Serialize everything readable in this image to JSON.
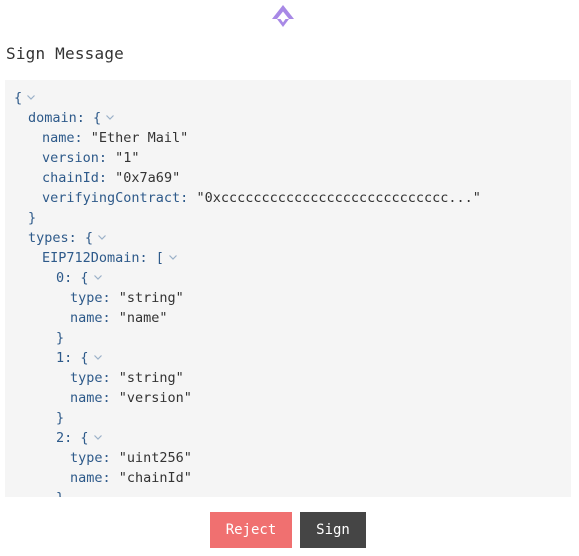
{
  "header": {
    "logo": "app-logo-icon",
    "title": "Sign Message"
  },
  "colors": {
    "accent": "#a889e6",
    "key_text": "#2e5a8a",
    "value_text": "#333333",
    "reject_bg": "#f07070",
    "sign_bg": "#454545",
    "panel_bg": "#f5f5f5"
  },
  "message_lines": [
    {
      "indent": 0,
      "key": "",
      "punct": "{",
      "value": "",
      "chevron": true
    },
    {
      "indent": 1,
      "key": "domain",
      "punct": ": {",
      "value": "",
      "chevron": true
    },
    {
      "indent": 2,
      "key": "name",
      "punct": ": ",
      "value": "\"Ether Mail\"",
      "chevron": false
    },
    {
      "indent": 2,
      "key": "version",
      "punct": ": ",
      "value": "\"1\"",
      "chevron": false
    },
    {
      "indent": 2,
      "key": "chainId",
      "punct": ": ",
      "value": "\"0x7a69\"",
      "chevron": false
    },
    {
      "indent": 2,
      "key": "verifyingContract",
      "punct": ": ",
      "value": "\"0xcccccccccccccccccccccccccccc...\"",
      "chevron": false
    },
    {
      "indent": 1,
      "key": "",
      "punct": "}",
      "value": "",
      "chevron": false
    },
    {
      "indent": 1,
      "key": "types",
      "punct": ": {",
      "value": "",
      "chevron": true
    },
    {
      "indent": 2,
      "key": "EIP712Domain",
      "punct": ": [",
      "value": "",
      "chevron": true
    },
    {
      "indent": 3,
      "key": "0",
      "punct": ": {",
      "value": "",
      "chevron": true
    },
    {
      "indent": 4,
      "key": "type",
      "punct": ": ",
      "value": "\"string\"",
      "chevron": false
    },
    {
      "indent": 4,
      "key": "name",
      "punct": ": ",
      "value": "\"name\"",
      "chevron": false
    },
    {
      "indent": 3,
      "key": "",
      "punct": "}",
      "value": "",
      "chevron": false
    },
    {
      "indent": 3,
      "key": "1",
      "punct": ": {",
      "value": "",
      "chevron": true
    },
    {
      "indent": 4,
      "key": "type",
      "punct": ": ",
      "value": "\"string\"",
      "chevron": false
    },
    {
      "indent": 4,
      "key": "name",
      "punct": ": ",
      "value": "\"version\"",
      "chevron": false
    },
    {
      "indent": 3,
      "key": "",
      "punct": "}",
      "value": "",
      "chevron": false
    },
    {
      "indent": 3,
      "key": "2",
      "punct": ": {",
      "value": "",
      "chevron": true
    },
    {
      "indent": 4,
      "key": "type",
      "punct": ": ",
      "value": "\"uint256\"",
      "chevron": false
    },
    {
      "indent": 4,
      "key": "name",
      "punct": ": ",
      "value": "\"chainId\"",
      "chevron": false
    },
    {
      "indent": 3,
      "key": "",
      "punct": "}",
      "value": "",
      "chevron": false
    }
  ],
  "actions": {
    "reject_label": "Reject",
    "sign_label": "Sign"
  }
}
